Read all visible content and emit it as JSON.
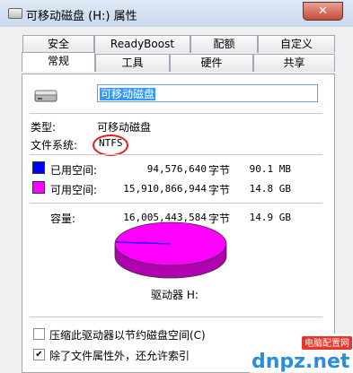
{
  "window": {
    "title": "可移动磁盘 (H:) 属性",
    "close_label": "✕"
  },
  "tabs_back": [
    "安全",
    "ReadyBoost",
    "配额",
    "自定义"
  ],
  "tabs_front": [
    "常规",
    "工具",
    "硬件",
    "共享"
  ],
  "drive_name": "可移动磁盘",
  "type_label": "类型:",
  "type_value": "可移动磁盘",
  "fs_label": "文件系统:",
  "fs_value": "NTFS",
  "used": {
    "label": "已用空间:",
    "bytes": "94,576,640",
    "unit": "字节",
    "size": "90.1 MB",
    "color": "#0000ff"
  },
  "free": {
    "label": "可用空间:",
    "bytes": "15,910,866,944",
    "unit": "字节",
    "size": "14.8 GB",
    "color": "#ff00ff"
  },
  "capacity": {
    "label": "容量:",
    "bytes": "16,005,443,584",
    "unit": "字节",
    "size": "14.9 GB"
  },
  "drive_label": "驱动器 H:",
  "compress_label": "压缩此驱动器以节约磁盘空间(C)",
  "index_label": "除了文件属性外，还允许索引",
  "compress_checked": false,
  "index_checked": true,
  "watermark": {
    "logo": "dnpz.net",
    "caption": "电脑配置网"
  }
}
